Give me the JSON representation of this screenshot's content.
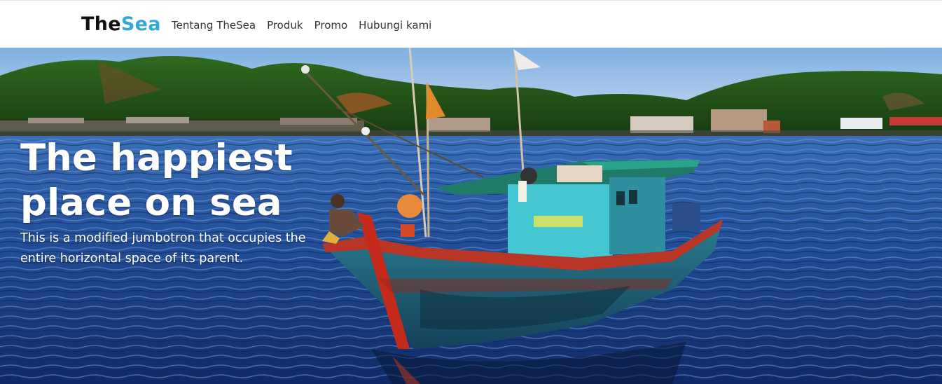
{
  "navbar": {
    "brand_part1": "The",
    "brand_part2": "Sea",
    "links": [
      {
        "label": "Tentang TheSea"
      },
      {
        "label": "Produk"
      },
      {
        "label": "Promo"
      },
      {
        "label": "Hubungi kami"
      }
    ]
  },
  "hero": {
    "title": "The happiest place on sea",
    "lead": "This is a modified jumbotron that occupies the entire horizontal space of its parent."
  },
  "colors": {
    "brand_dark": "#111111",
    "brand_accent": "#35a9d4",
    "nav_text": "#333333",
    "hero_text": "#ffffff"
  }
}
